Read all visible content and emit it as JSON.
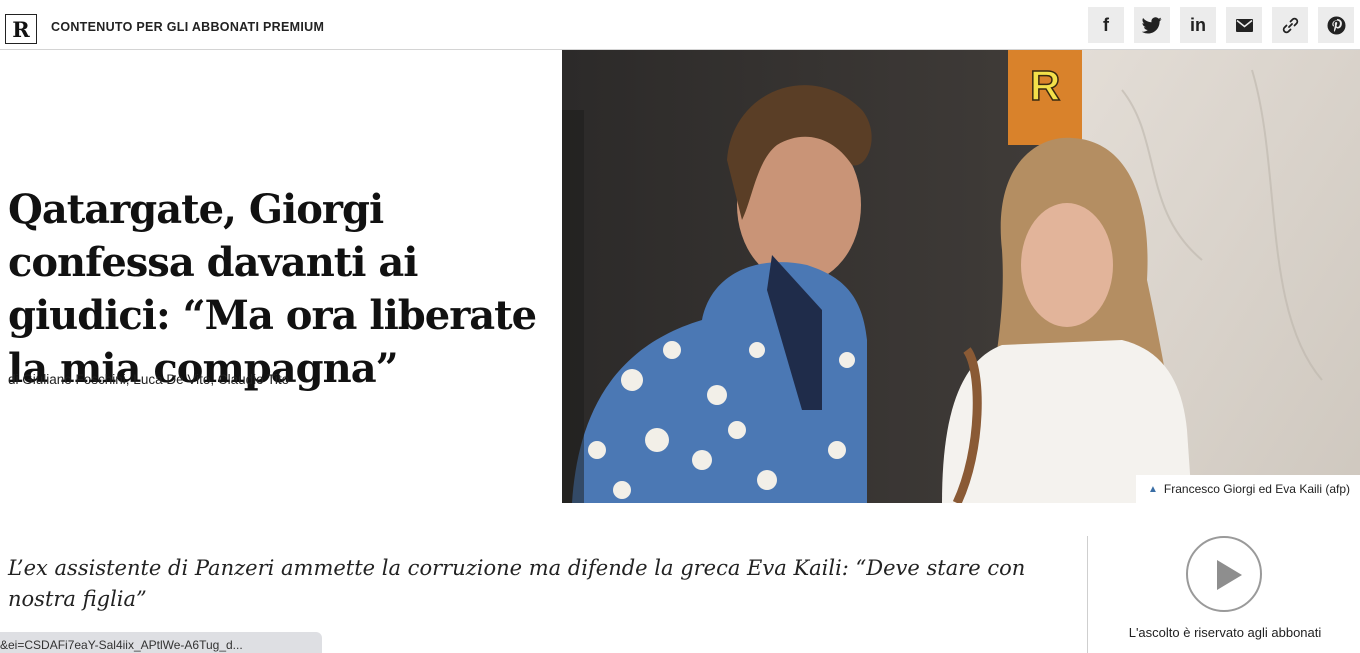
{
  "header": {
    "logo_letter": "R",
    "premium_label": "CONTENUTO PER GLI ABBONATI PREMIUM",
    "share": [
      {
        "name": "facebook-icon",
        "glyph": "f"
      },
      {
        "name": "twitter-icon",
        "glyph": ""
      },
      {
        "name": "linkedin-icon",
        "glyph": "in"
      },
      {
        "name": "email-icon",
        "glyph": ""
      },
      {
        "name": "link-icon",
        "glyph": ""
      },
      {
        "name": "pinterest-icon",
        "glyph": ""
      }
    ]
  },
  "article": {
    "headline": "Qatargate, Giorgi confessa davanti ai giudici: “Ma ora liberate la mia compagna”",
    "byline": "di Giuliano Foschini, Luca De Vito, Claudio Tito",
    "image_caption": "Francesco Giorgi ed Eva Kaili (afp)",
    "subtitle": "L’ex assistente di Panzeri ammette la corruzione ma difende la greca Eva Kaili: “Deve stare con nostra figlia”"
  },
  "audio": {
    "note": "L'ascolto è riservato agli abbonati"
  },
  "status_url": "&ei=CSDAFi7eaY-Sal4iix_APtlWe-A6Tug_d..."
}
